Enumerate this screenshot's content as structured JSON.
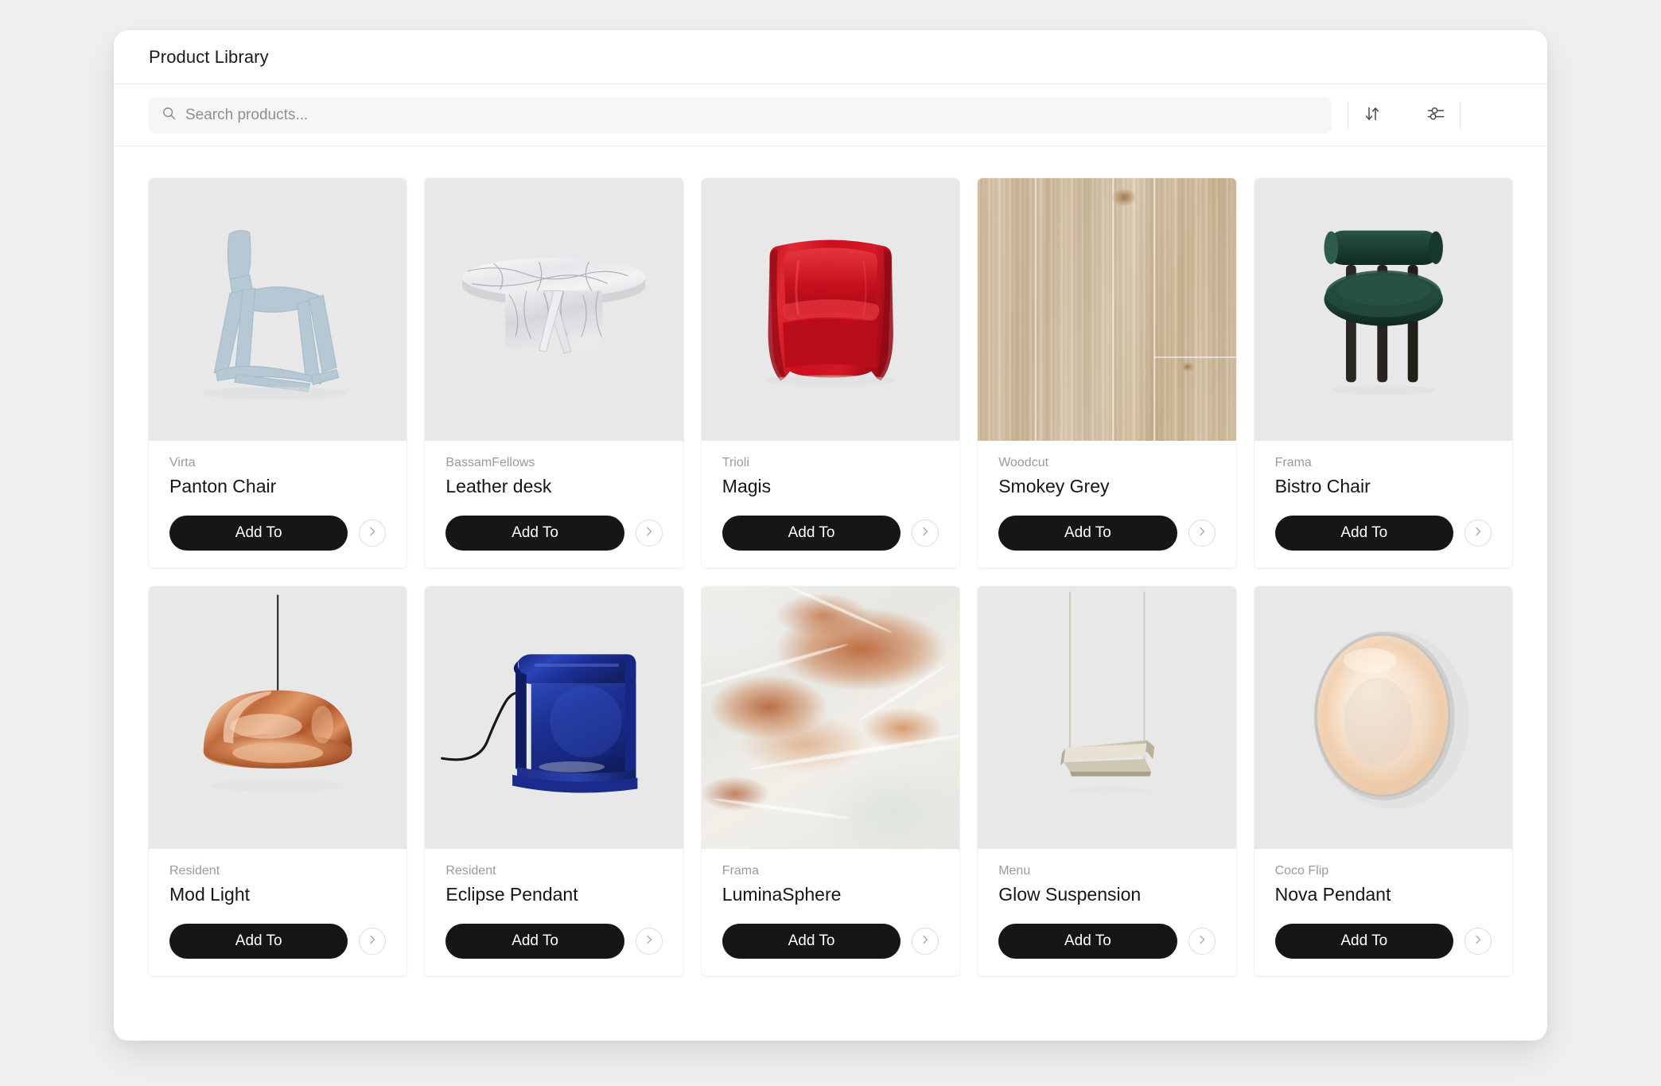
{
  "window": {
    "title": "Product Library"
  },
  "toolbar": {
    "search": {
      "placeholder": "Search products...",
      "value": "",
      "icon": "search-icon"
    },
    "sort_icon": "sort-arrows-icon",
    "filter_icon": "filter-sliders-icon"
  },
  "card_action": {
    "add_label": "Add To",
    "chevron_icon": "chevron-right-icon"
  },
  "products": [
    {
      "brand": "Virta",
      "name": "Panton Chair",
      "art": "blue-chair",
      "media_style": "inset"
    },
    {
      "brand": "BassamFellows",
      "name": "Leather desk",
      "art": "marble-table",
      "media_style": "inset"
    },
    {
      "brand": "Trioli",
      "name": "Magis",
      "art": "red-tub-chair",
      "media_style": "inset"
    },
    {
      "brand": "Woodcut",
      "name": "Smokey Grey",
      "art": "oak-wood-texture",
      "media_style": "bleed"
    },
    {
      "brand": "Frama",
      "name": "Bistro Chair",
      "art": "green-fat-chair",
      "media_style": "inset"
    },
    {
      "brand": "Resident",
      "name": "Mod Light",
      "art": "copper-pendant",
      "media_style": "inset"
    },
    {
      "brand": "Resident",
      "name": "Eclipse Pendant",
      "art": "blue-desk-lamp",
      "media_style": "inset"
    },
    {
      "brand": "Frama",
      "name": "LuminaSphere",
      "art": "onyx-texture",
      "media_style": "bleed"
    },
    {
      "brand": "Menu",
      "name": "Glow Suspension",
      "art": "linear-suspension",
      "media_style": "inset"
    },
    {
      "brand": "Coco Flip",
      "name": "Nova Pendant",
      "art": "disc-wall-light",
      "media_style": "inset"
    }
  ],
  "colors": {
    "page_background": "#f0f0f0",
    "window_background": "#ffffff",
    "media_background": "#e8e8e8",
    "button_background": "#161616",
    "button_text": "#ffffff",
    "brand_text": "#9a9a9e",
    "product_text": "#151515",
    "accent_blue_chair": "#b4c6d2",
    "accent_red_chair": "#cf1424",
    "accent_green_chair": "#1d4034",
    "accent_copper": "#c9784a",
    "accent_blue_lamp": "#1a2f86",
    "accent_wood": "#cdb99c",
    "accent_onyx": "#c3703c"
  }
}
